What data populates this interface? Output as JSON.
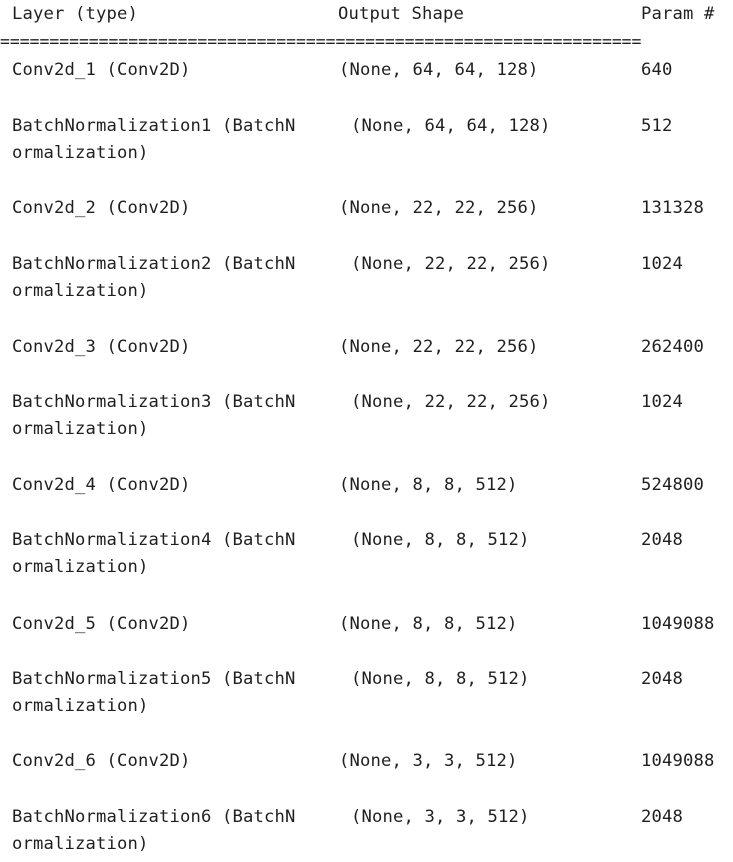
{
  "header": {
    "layer_col": "Layer (type)",
    "shape_col": "Output Shape",
    "param_col": "Param #"
  },
  "separator": "=================================================================",
  "rows": [
    {
      "layer": "Conv2d_1 (Conv2D)",
      "shape": "(None, 64, 64, 128)",
      "params": "640"
    },
    {
      "layer": "BatchNormalization1 (BatchN",
      "layer_cont": "ormalization)",
      "shape": "(None, 64, 64, 128)",
      "params": "512"
    },
    {
      "layer": "Conv2d_2 (Conv2D)",
      "shape": "(None, 22, 22, 256)",
      "params": "131328"
    },
    {
      "layer": "BatchNormalization2 (BatchN",
      "layer_cont": "ormalization)",
      "shape": "(None, 22, 22, 256)",
      "params": "1024"
    },
    {
      "layer": "Conv2d_3 (Conv2D)",
      "shape": "(None, 22, 22, 256)",
      "params": "262400"
    },
    {
      "layer": "BatchNormalization3 (BatchN",
      "layer_cont": "ormalization)",
      "shape": "(None, 22, 22, 256)",
      "params": "1024"
    },
    {
      "layer": "Conv2d_4 (Conv2D)",
      "shape": "(None, 8, 8, 512)",
      "params": "524800"
    },
    {
      "layer": "BatchNormalization4 (BatchN",
      "layer_cont": "ormalization)",
      "shape": "(None, 8, 8, 512)",
      "params": "2048"
    },
    {
      "layer": "Conv2d_5 (Conv2D)",
      "shape": "(None, 8, 8, 512)",
      "params": "1049088"
    },
    {
      "layer": "BatchNormalization5 (BatchN",
      "layer_cont": "ormalization)",
      "shape": "(None, 8, 8, 512)",
      "params": "2048"
    },
    {
      "layer": "Conv2d_6 (Conv2D)",
      "shape": "(None, 3, 3, 512)",
      "params": "1049088"
    },
    {
      "layer": "BatchNormalization6 (BatchN",
      "layer_cont": "ormalization)",
      "shape": "(None, 3, 3, 512)",
      "params": "2048"
    }
  ]
}
